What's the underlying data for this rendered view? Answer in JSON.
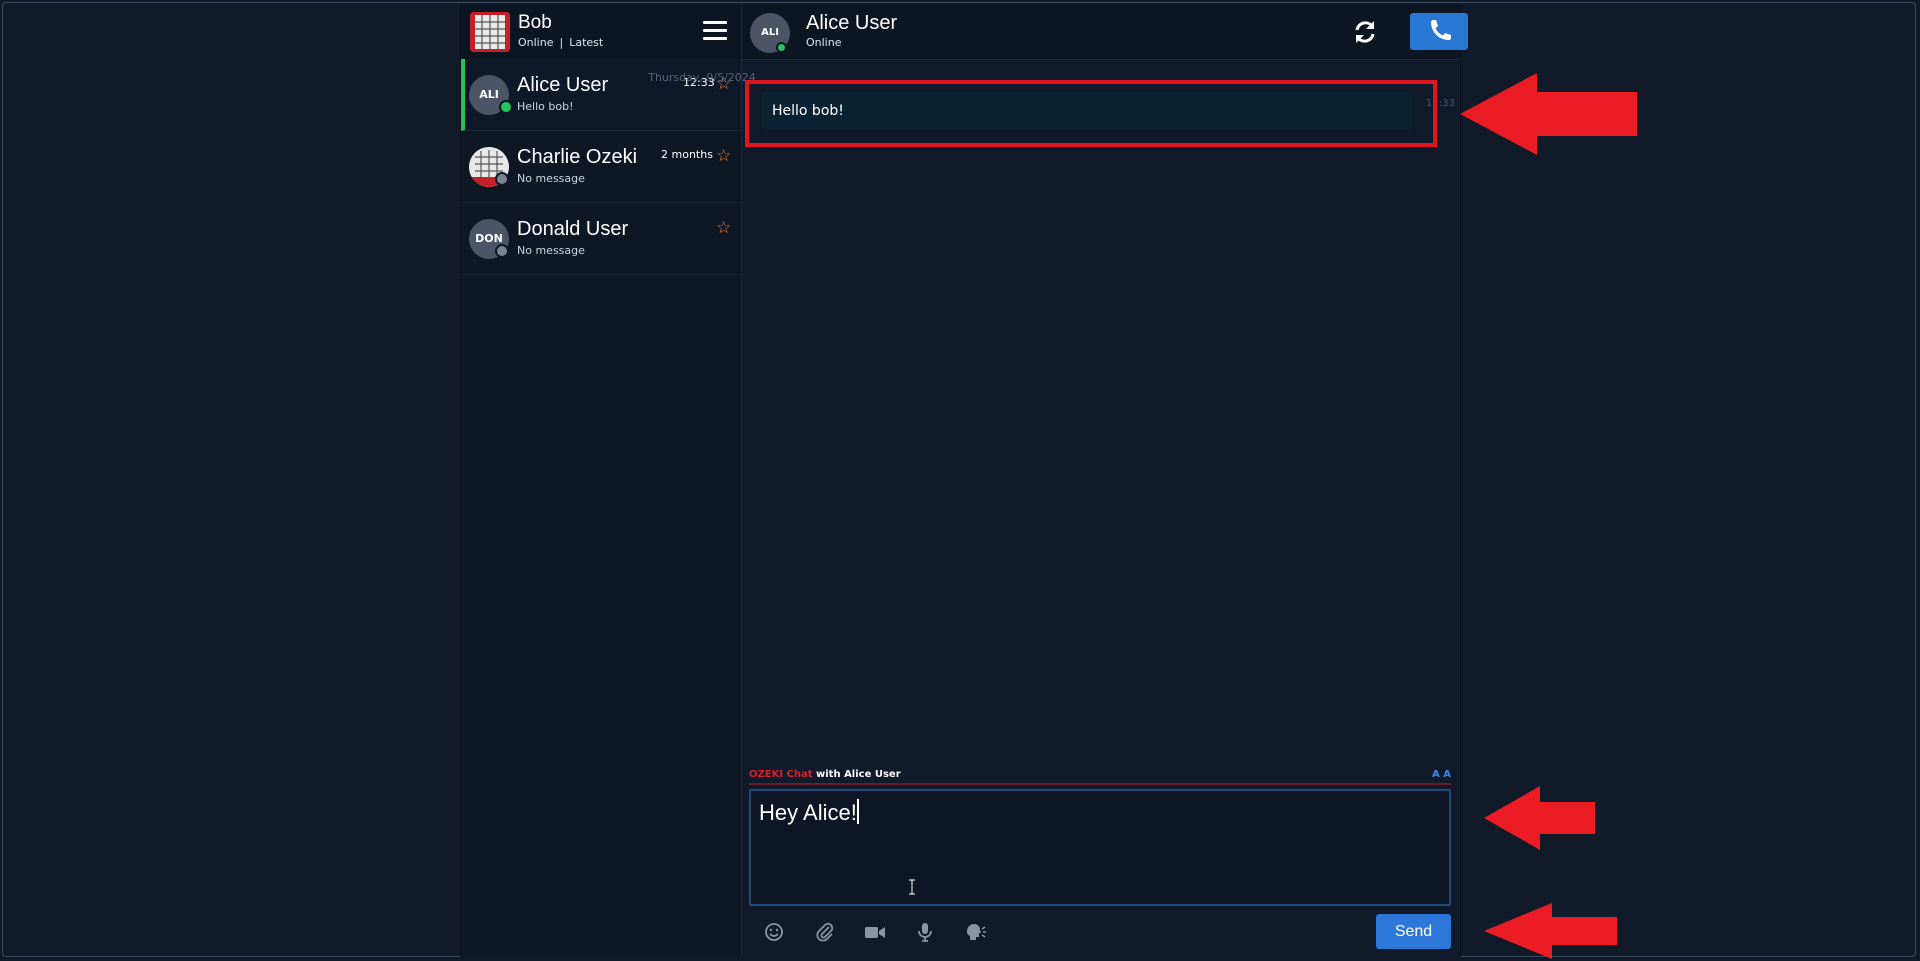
{
  "me": {
    "name": "Bob",
    "status": "Online",
    "separator": "|",
    "filter": "Latest"
  },
  "contacts": [
    {
      "initials": "ALI",
      "name": "Alice User",
      "last_message": "Hello bob!",
      "time": "12:33",
      "presence_color": "#22c55e",
      "active": true
    },
    {
      "initials": "",
      "name": "Charlie Ozeki",
      "last_message": "No message",
      "time": "2 months",
      "presence_color": "#7a8494",
      "active": false
    },
    {
      "initials": "DON",
      "name": "Donald User",
      "last_message": "No message",
      "time": "",
      "presence_color": "#7a8494",
      "active": false
    }
  ],
  "chat_header": {
    "initials": "ALI",
    "name": "Alice User",
    "status": "Online"
  },
  "messages": {
    "date_separator": "Thursday, 9/5/2024",
    "items": [
      {
        "text": "Hello bob!",
        "time": "12:33"
      }
    ]
  },
  "composer": {
    "brand": "OZEKI Chat",
    "with_text": "with Alice User",
    "font_controls": "A A",
    "value": "Hey Alice!",
    "send_label": "Send"
  },
  "colors": {
    "accent_blue": "#2c77d8",
    "online_green": "#22c55e",
    "annotation_red": "#e0151f",
    "brand_red": "#d4202a"
  },
  "icons": [
    "menu-icon",
    "refresh-icon",
    "phone-icon",
    "star-icon",
    "emoji-icon",
    "attach-icon",
    "video-icon",
    "microphone-icon",
    "voice-message-icon"
  ]
}
